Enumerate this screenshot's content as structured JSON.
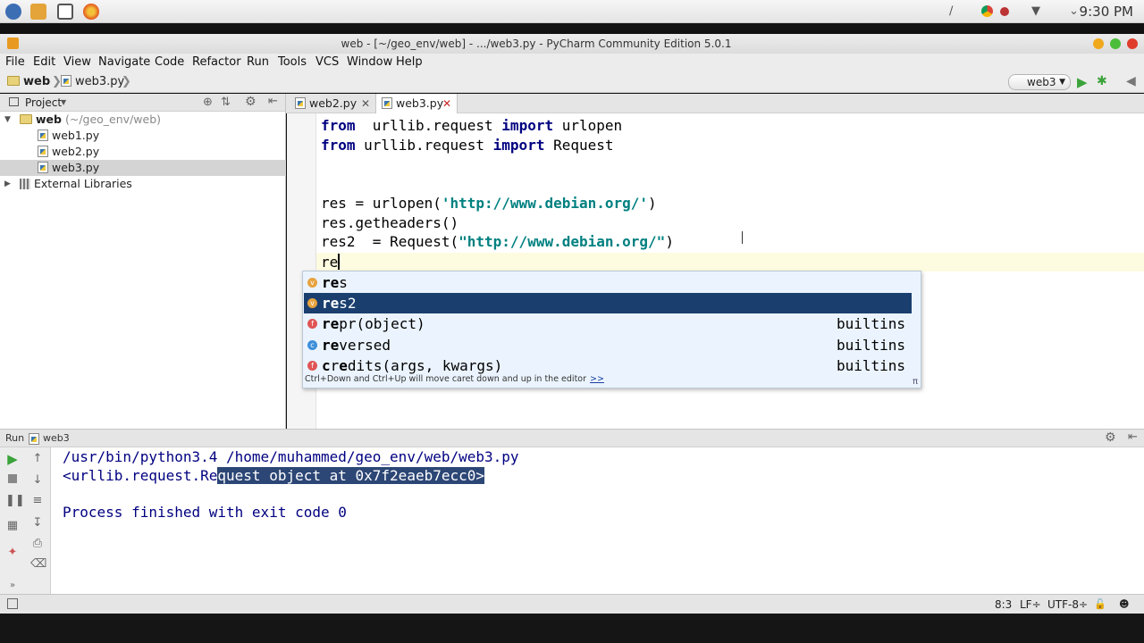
{
  "os": {
    "clock": "9:30 PM",
    "launcher_icons": [
      "fedora-icon",
      "files-icon",
      "terminal-icon",
      "firefox-icon"
    ],
    "tray_icons": [
      "attachment-icon",
      "chrome-icon",
      "record-icon",
      "wifi-icon",
      "chevron-down-icon"
    ]
  },
  "window": {
    "title": "web - [~/geo_env/web] - .../web3.py - PyCharm Community Edition 5.0.1",
    "controls_colors": {
      "minimize": "#f0a81c",
      "maximize": "#4bbd3a",
      "close": "#e03c2c"
    }
  },
  "menu": [
    "File",
    "Edit",
    "View",
    "Navigate",
    "Code",
    "Refactor",
    "Run",
    "Tools",
    "VCS",
    "Window",
    "Help"
  ],
  "breadcrumb": {
    "project": "web",
    "file": "web3.py"
  },
  "run_config": {
    "label": "web3"
  },
  "project_panel": {
    "title": "Project",
    "root": {
      "name": "web",
      "path": "(~/geo_env/web)"
    },
    "files": [
      "web1.py",
      "web2.py",
      "web3.py"
    ],
    "selected_file": "web3.py",
    "external": "External Libraries"
  },
  "tabs": [
    {
      "label": "web2.py",
      "active": false
    },
    {
      "label": "web3.py",
      "active": true
    }
  ],
  "editor": {
    "lines": [
      {
        "kw": "from",
        "rest": "  urllib.request ",
        "kw2": "import",
        "rest2": " urlopen"
      },
      {
        "kw": "from",
        "rest": " urllib.request ",
        "kw2": "import",
        "rest2": " Request"
      },
      {},
      {},
      {
        "pre": "res = urlopen(",
        "str": "'http://www.debian.org/'",
        "post": ")"
      },
      {
        "pre": "res.getheaders()"
      },
      {
        "pre": "res2  = Request(",
        "str": "\"http://www.debian.org/\"",
        "post": ")"
      },
      {
        "pre": "re"
      }
    ]
  },
  "completion": {
    "items": [
      {
        "badge": "v",
        "badge_color": "#e7a33e",
        "match": "re",
        "rest": "s",
        "tail": "",
        "selected": false
      },
      {
        "badge": "v",
        "badge_color": "#e7a33e",
        "match": "re",
        "rest": "s2",
        "tail": "",
        "selected": true
      },
      {
        "badge": "f",
        "badge_color": "#e05555",
        "match": "re",
        "rest": "pr(object)",
        "tail": "builtins",
        "selected": false
      },
      {
        "badge": "c",
        "badge_color": "#3d8fd9",
        "match": "re",
        "rest": "versed",
        "tail": "builtins",
        "selected": false
      },
      {
        "badge": "f",
        "badge_color": "#e05555",
        "match": "c",
        "rest": "r",
        "match2": "e",
        "rest2": "dits(args, kwargs)",
        "tail": "builtins",
        "selected": false
      }
    ],
    "hint": "Ctrl+Down and Ctrl+Up will move caret down and up in the editor",
    "hint_link": ">>",
    "pi": "π"
  },
  "run_panel": {
    "label": "Run",
    "config": "web3",
    "console": {
      "line1": "/usr/bin/python3.4 /home/muhammed/geo_env/web/web3.py",
      "line2_plain": "<urllib.request.Re",
      "line2_selected": "quest object at 0x7f2eaeb7ecc0>",
      "line3": "Process finished with exit code 0"
    }
  },
  "status": {
    "position": "8:3",
    "line_sep": "LF÷",
    "encoding": "UTF-8÷"
  }
}
